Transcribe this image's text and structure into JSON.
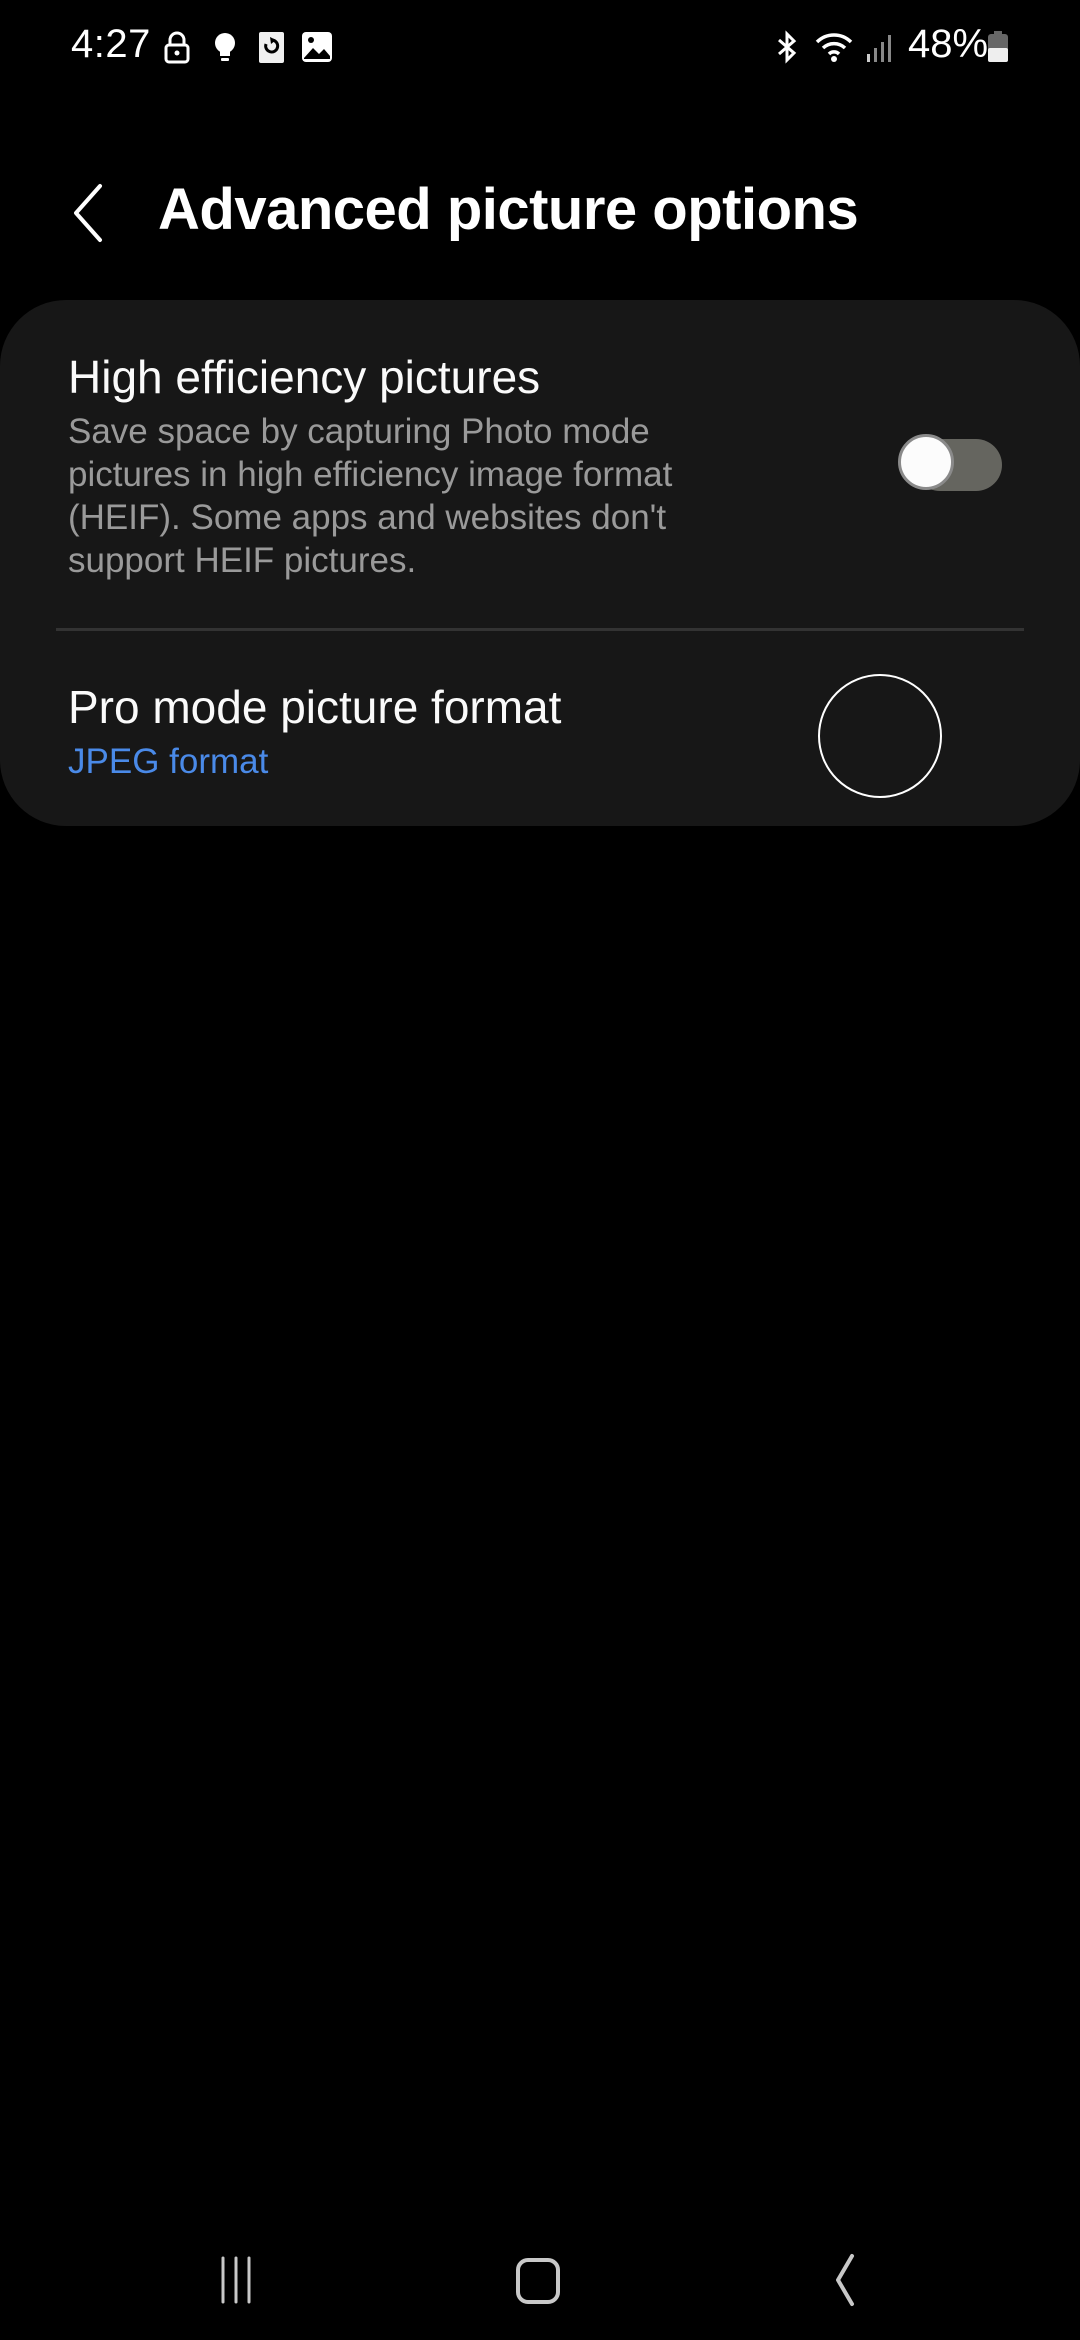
{
  "status_bar": {
    "time": "4:27",
    "left_icons": [
      "lock-icon",
      "lightbulb-icon",
      "sync-app-icon",
      "gallery-icon"
    ],
    "right_icons": [
      "bluetooth-icon",
      "wifi-icon",
      "signal-icon",
      "battery-icon"
    ],
    "battery_percent": "48%",
    "battery_level": 0.48
  },
  "app_bar": {
    "back_icon": "chevron-left-icon",
    "title": "Advanced picture options"
  },
  "settings": {
    "items": [
      {
        "title": "High efficiency pictures",
        "description": "Save space by capturing Photo mode pictures in high efficiency image format (HEIF). Some apps and websites don't support HEIF pictures.",
        "control": "toggle",
        "enabled": false
      },
      {
        "title": "Pro mode picture format",
        "value": "JPEG format"
      }
    ]
  },
  "colors": {
    "background": "#000000",
    "card": "#171717",
    "accent": "#4a8ae8",
    "secondary_text": "#9a9a9a",
    "toggle_track_off": "#65655f"
  },
  "nav_bar": {
    "buttons": [
      "recents-icon",
      "home-icon",
      "back-icon"
    ]
  }
}
